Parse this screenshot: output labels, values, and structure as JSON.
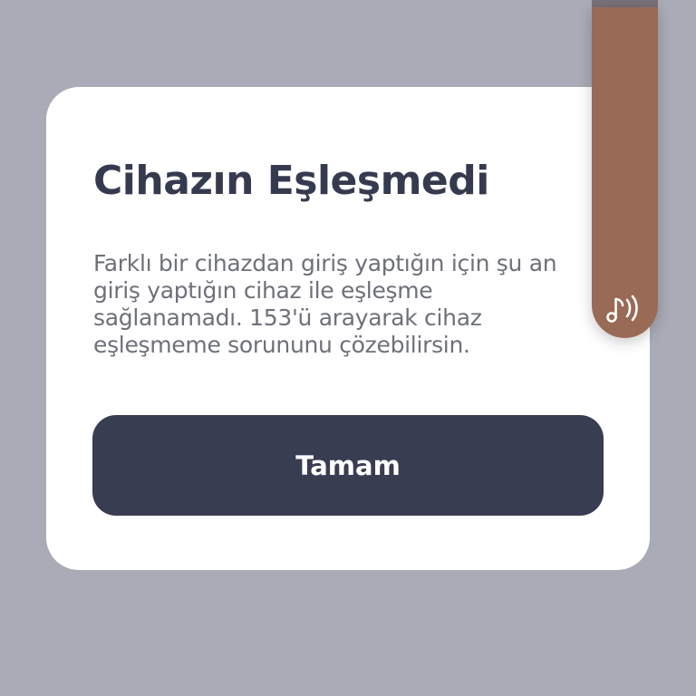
{
  "dialog": {
    "title": "Cihazın Eşleşmedi",
    "message": "Farklı bir cihazdan giriş yaptığın için şu an giriş yaptığın cihaz ile eşleşme sağlanamadı. 153'ü arayarak cihaz eşleşmeme sorununu çözebilirsin.",
    "ok_label": "Tamam"
  },
  "audio_tab": {
    "icon": "sound-note-icon",
    "color": "#996a55"
  },
  "colors": {
    "backdrop": "#a9acb6",
    "title": "#363a4f",
    "message": "#6e707a",
    "button": "#393d52"
  }
}
